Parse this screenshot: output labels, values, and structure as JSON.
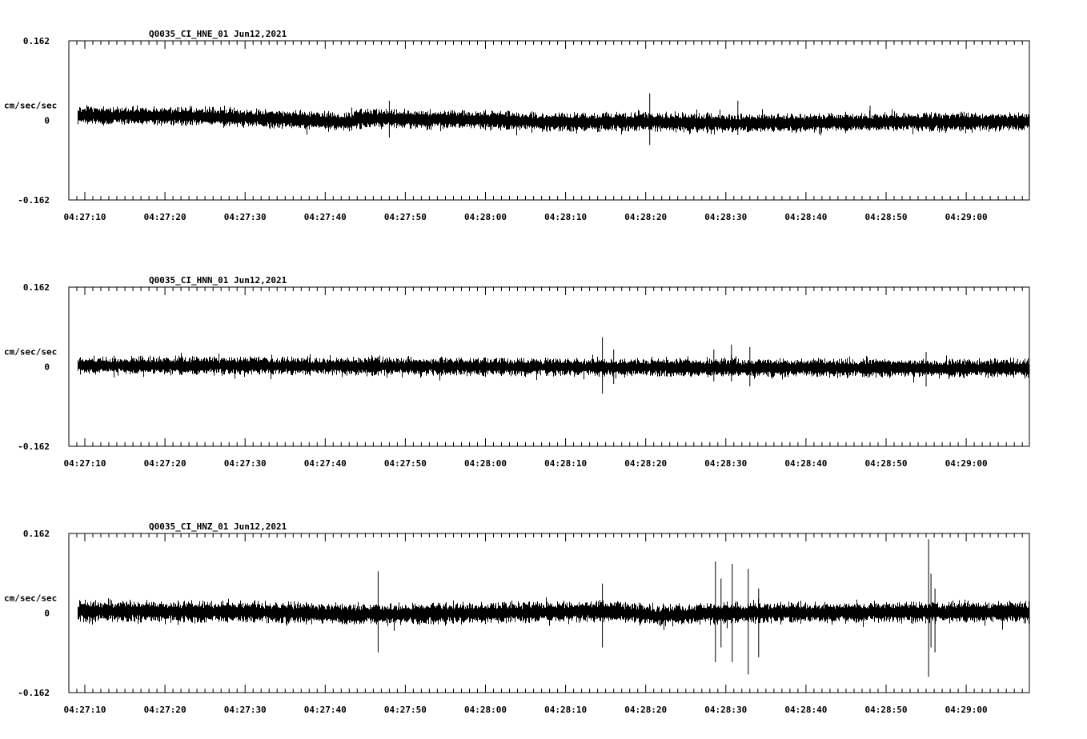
{
  "chart_data": [
    {
      "type": "line",
      "title": "Q0035_CI_HNE_01  Jun12,2021",
      "ylabel": "cm/sec/sec",
      "ylim": [
        -0.162,
        0.162
      ],
      "y_tick_labels": [
        "0.162",
        "0",
        "-0.162"
      ],
      "x_tick_labels": [
        "04:27:10",
        "04:27:20",
        "04:27:30",
        "04:27:40",
        "04:27:50",
        "04:28:00",
        "04:28:10",
        "04:28:20",
        "04:28:30",
        "04:28:40",
        "04:28:50",
        "04:29:00"
      ],
      "noise_amplitude": 0.018,
      "drift": [
        [
          0,
          0.01
        ],
        [
          25,
          0.008
        ],
        [
          43,
          -0.003
        ],
        [
          44,
          0.004
        ],
        [
          60,
          0.001
        ],
        [
          68,
          -0.004
        ],
        [
          80,
          -0.003
        ],
        [
          90,
          -0.006
        ],
        [
          118,
          -0.003
        ]
      ],
      "spikes": [
        [
          48.0,
          0.04,
          -0.035
        ],
        [
          80.5,
          0.055,
          -0.05
        ],
        [
          91.5,
          0.04,
          -0.03
        ],
        [
          108.0,
          0.03,
          -0.02
        ]
      ]
    },
    {
      "type": "line",
      "title": "Q0035_CI_HNN_01  Jun12,2021",
      "ylabel": "cm/sec/sec",
      "ylim": [
        -0.162,
        0.162
      ],
      "y_tick_labels": [
        "0.162",
        "0",
        "-0.162"
      ],
      "x_tick_labels": [
        "04:27:10",
        "04:27:20",
        "04:27:30",
        "04:27:40",
        "04:27:50",
        "04:28:00",
        "04:28:10",
        "04:28:20",
        "04:28:30",
        "04:28:40",
        "04:28:50",
        "04:29:00"
      ],
      "noise_amplitude": 0.017,
      "drift": [
        [
          0,
          0.003
        ],
        [
          30,
          0.002
        ],
        [
          60,
          0.0
        ],
        [
          90,
          -0.002
        ],
        [
          118,
          -0.003
        ]
      ],
      "spikes": [
        [
          74.6,
          0.06,
          -0.055
        ],
        [
          76.0,
          0.035,
          -0.035
        ],
        [
          88.5,
          0.035,
          -0.03
        ],
        [
          90.7,
          0.045,
          -0.03
        ],
        [
          93.0,
          0.04,
          -0.04
        ],
        [
          115.0,
          0.03,
          -0.04
        ]
      ]
    },
    {
      "type": "line",
      "title": "Q0035_CI_HNZ_01  Jun12,2021",
      "ylabel": "cm/sec/sec",
      "ylim": [
        -0.162,
        0.162
      ],
      "y_tick_labels": [
        "0.162",
        "0",
        "-0.162"
      ],
      "x_tick_labels": [
        "04:27:10",
        "04:27:20",
        "04:27:30",
        "04:27:40",
        "04:27:50",
        "04:28:00",
        "04:28:10",
        "04:28:20",
        "04:28:30",
        "04:28:40",
        "04:28:50",
        "04:29:00"
      ],
      "noise_amplitude": 0.02,
      "drift": [
        [
          0,
          0.004
        ],
        [
          30,
          0.002
        ],
        [
          45,
          -0.003
        ],
        [
          60,
          0.0
        ],
        [
          74,
          0.004
        ],
        [
          82,
          -0.005
        ],
        [
          90,
          0.0
        ],
        [
          118,
          0.002
        ]
      ],
      "spikes": [
        [
          46.6,
          0.085,
          -0.08
        ],
        [
          74.6,
          0.06,
          -0.07
        ],
        [
          88.7,
          0.105,
          -0.1
        ],
        [
          89.4,
          0.07,
          -0.07
        ],
        [
          90.8,
          0.1,
          -0.1
        ],
        [
          92.8,
          0.09,
          -0.125
        ],
        [
          94.1,
          0.05,
          -0.09
        ],
        [
          115.3,
          0.15,
          -0.13
        ],
        [
          115.6,
          0.08,
          -0.07
        ],
        [
          116.1,
          0.05,
          -0.08
        ]
      ]
    }
  ]
}
